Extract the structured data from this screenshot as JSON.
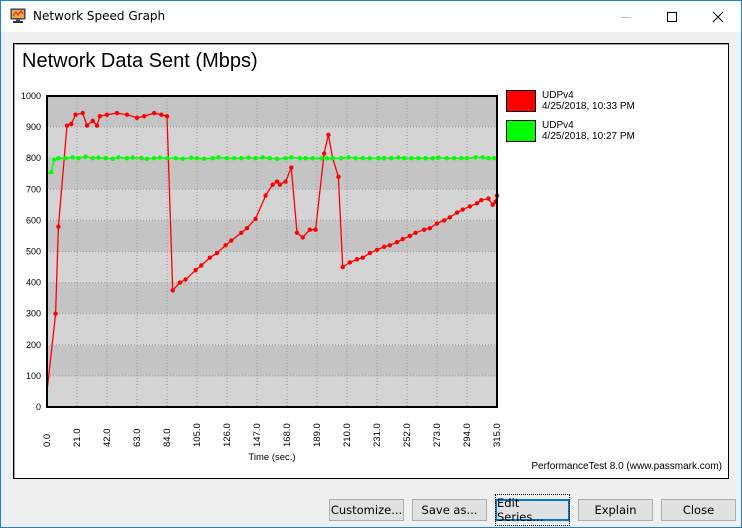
{
  "window": {
    "title": "Network Speed Graph",
    "controls": [
      "minimize",
      "maximize",
      "close"
    ]
  },
  "footer_text": "PerformanceTest 8.0 (www.passmark.com)",
  "buttons": [
    {
      "label": "Customize...",
      "name": "customize-button"
    },
    {
      "label": "Save as...",
      "name": "save-as-button"
    },
    {
      "label": "Edit Series...",
      "name": "edit-series-button",
      "focused": true
    },
    {
      "label": "Explain",
      "name": "explain-button"
    },
    {
      "label": "Close",
      "name": "close-dialog-button"
    }
  ],
  "chart_data": {
    "type": "line",
    "title": "Network Data Sent (Mbps)",
    "xlabel": "Time (sec.)",
    "ylabel": "",
    "xlim": [
      0,
      315
    ],
    "ylim": [
      0,
      1000
    ],
    "x_ticks": [
      "0.0",
      "21.0",
      "42.0",
      "63.0",
      "84.0",
      "105.0",
      "126.0",
      "147.0",
      "168.0",
      "189.0",
      "210.0",
      "231.0",
      "252.0",
      "273.0",
      "294.0",
      "315.0"
    ],
    "y_ticks": [
      "0",
      "100",
      "200",
      "300",
      "400",
      "500",
      "600",
      "700",
      "800",
      "900",
      "1000"
    ],
    "grid": true,
    "legend": "right",
    "series": [
      {
        "name": "UDPv4",
        "date": "4/25/2018, 10:33 PM",
        "color": "#ff0000",
        "points": [
          [
            0,
            50
          ],
          [
            6,
            300
          ],
          [
            8,
            580
          ],
          [
            14,
            905
          ],
          [
            17,
            910
          ],
          [
            20,
            940
          ],
          [
            25,
            945
          ],
          [
            28,
            905
          ],
          [
            32,
            920
          ],
          [
            35,
            905
          ],
          [
            37,
            935
          ],
          [
            42,
            940
          ],
          [
            49,
            945
          ],
          [
            56,
            940
          ],
          [
            63,
            930
          ],
          [
            68,
            935
          ],
          [
            75,
            945
          ],
          [
            80,
            940
          ],
          [
            84,
            935
          ],
          [
            88,
            375
          ],
          [
            93,
            400
          ],
          [
            97,
            410
          ],
          [
            104,
            440
          ],
          [
            108,
            455
          ],
          [
            114,
            480
          ],
          [
            119,
            495
          ],
          [
            125,
            520
          ],
          [
            129,
            535
          ],
          [
            136,
            560
          ],
          [
            140,
            575
          ],
          [
            146,
            605
          ],
          [
            153,
            680
          ],
          [
            158,
            715
          ],
          [
            161,
            725
          ],
          [
            163,
            715
          ],
          [
            167,
            725
          ],
          [
            171,
            770
          ],
          [
            175,
            560
          ],
          [
            179,
            545
          ],
          [
            184,
            570
          ],
          [
            188,
            570
          ],
          [
            194,
            815
          ],
          [
            197,
            875
          ],
          [
            200,
            800
          ],
          [
            204,
            740
          ],
          [
            207,
            450
          ],
          [
            212,
            465
          ],
          [
            217,
            475
          ],
          [
            221,
            480
          ],
          [
            226,
            495
          ],
          [
            231,
            505
          ],
          [
            236,
            515
          ],
          [
            240,
            520
          ],
          [
            245,
            530
          ],
          [
            249,
            540
          ],
          [
            254,
            550
          ],
          [
            258,
            560
          ],
          [
            264,
            570
          ],
          [
            268,
            575
          ],
          [
            273,
            590
          ],
          [
            278,
            600
          ],
          [
            282,
            610
          ],
          [
            287,
            625
          ],
          [
            291,
            635
          ],
          [
            296,
            645
          ],
          [
            301,
            655
          ],
          [
            304,
            665
          ],
          [
            309,
            670
          ],
          [
            312,
            650
          ],
          [
            314,
            660
          ],
          [
            318,
            680
          ]
        ]
      },
      {
        "name": "UDPv4",
        "date": "4/25/2018, 10:27 PM",
        "color": "#00ff00",
        "points": [
          [
            0,
            750
          ],
          [
            3,
            755
          ],
          [
            5,
            795
          ],
          [
            8,
            800
          ],
          [
            13,
            800
          ],
          [
            18,
            803
          ],
          [
            22,
            800
          ],
          [
            27,
            805
          ],
          [
            32,
            800
          ],
          [
            36,
            802
          ],
          [
            41,
            800
          ],
          [
            46,
            798
          ],
          [
            50,
            803
          ],
          [
            56,
            800
          ],
          [
            60,
            802
          ],
          [
            66,
            800
          ],
          [
            70,
            798
          ],
          [
            75,
            800
          ],
          [
            79,
            802
          ],
          [
            84,
            800
          ],
          [
            90,
            800
          ],
          [
            95,
            798
          ],
          [
            101,
            802
          ],
          [
            105,
            800
          ],
          [
            110,
            798
          ],
          [
            116,
            800
          ],
          [
            120,
            803
          ],
          [
            126,
            800
          ],
          [
            131,
            800
          ],
          [
            136,
            800
          ],
          [
            141,
            802
          ],
          [
            146,
            800
          ],
          [
            151,
            803
          ],
          [
            156,
            800
          ],
          [
            161,
            798
          ],
          [
            167,
            800
          ],
          [
            171,
            803
          ],
          [
            177,
            800
          ],
          [
            181,
            800
          ],
          [
            186,
            800
          ],
          [
            192,
            800
          ],
          [
            196,
            800
          ],
          [
            200,
            800
          ],
          [
            206,
            800
          ],
          [
            211,
            803
          ],
          [
            216,
            800
          ],
          [
            221,
            800
          ],
          [
            226,
            800
          ],
          [
            232,
            800
          ],
          [
            236,
            800
          ],
          [
            241,
            800
          ],
          [
            246,
            802
          ],
          [
            250,
            800
          ],
          [
            255,
            800
          ],
          [
            260,
            800
          ],
          [
            265,
            800
          ],
          [
            270,
            800
          ],
          [
            274,
            802
          ],
          [
            280,
            800
          ],
          [
            285,
            800
          ],
          [
            290,
            800
          ],
          [
            294,
            800
          ],
          [
            300,
            803
          ],
          [
            305,
            803
          ],
          [
            309,
            800
          ],
          [
            313,
            800
          ]
        ]
      }
    ]
  }
}
